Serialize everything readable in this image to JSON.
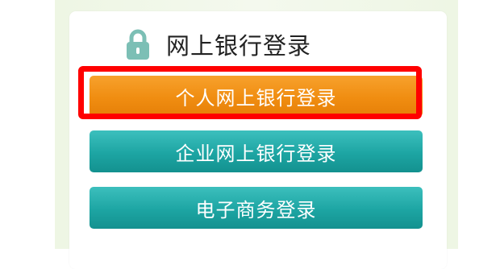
{
  "login_panel": {
    "title": "网上银行登录",
    "lock_icon": "lock-icon",
    "buttons": [
      {
        "label": "个人网上银行登录",
        "color": "#f08d11",
        "highlighted": true
      },
      {
        "label": "企业网上银行登录",
        "color": "#1da5a3",
        "highlighted": false
      },
      {
        "label": "电子商务登录",
        "color": "#1da5a3",
        "highlighted": false
      }
    ],
    "highlight_color": "#ff0000"
  }
}
